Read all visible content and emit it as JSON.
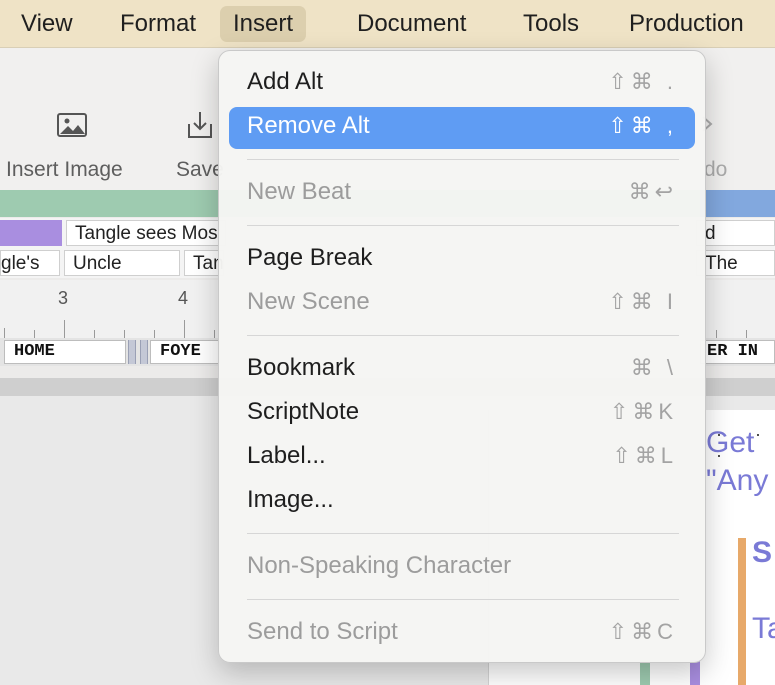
{
  "menubar": {
    "items": [
      "View",
      "Format",
      "Insert",
      "Document",
      "Tools",
      "Production"
    ],
    "active": "Insert"
  },
  "toolbar": {
    "insert_image_label": "Insert Image",
    "save_label": "Save",
    "redo_label": "do"
  },
  "timeline": {
    "row1": [
      "Tangle sees Mos",
      "d"
    ],
    "row2": [
      "gle's",
      "Uncle",
      "Tan",
      "The"
    ],
    "ruler": [
      "3",
      "4"
    ],
    "scenes": [
      "HOME",
      "FOYE",
      "ER IN"
    ]
  },
  "editor": {
    "lines": [
      "Get",
      "\"Any",
      "S",
      "Ta"
    ]
  },
  "menu": {
    "items": [
      {
        "label": "Add Alt",
        "shortcut": "⇧⌘ .",
        "state": "normal"
      },
      {
        "label": "Remove Alt",
        "shortcut": "⇧⌘ ,",
        "state": "highlighted"
      },
      {
        "label": "New Beat",
        "shortcut": "⌘↩",
        "state": "disabled"
      },
      {
        "label": "Page Break",
        "shortcut": "",
        "state": "normal"
      },
      {
        "label": "New Scene",
        "shortcut": "⇧⌘ I",
        "state": "disabled"
      },
      {
        "label": "Bookmark",
        "shortcut": "⌘ \\",
        "state": "normal"
      },
      {
        "label": "ScriptNote",
        "shortcut": "⇧⌘K",
        "state": "normal"
      },
      {
        "label": "Label...",
        "shortcut": "⇧⌘L",
        "state": "normal"
      },
      {
        "label": "Image...",
        "shortcut": "",
        "state": "normal"
      },
      {
        "label": "Non-Speaking Character",
        "shortcut": "",
        "state": "disabled"
      },
      {
        "label": "Send to Script",
        "shortcut": "⇧⌘C",
        "state": "disabled"
      }
    ]
  },
  "colors": {
    "menubar_bg": "#efe3c6",
    "menubar_active": "#dccfae",
    "highlight": "#5f9cf3",
    "track_green": "#9ecbb0",
    "track_blue": "#82a8de",
    "script_text": "#7a7ad6"
  }
}
